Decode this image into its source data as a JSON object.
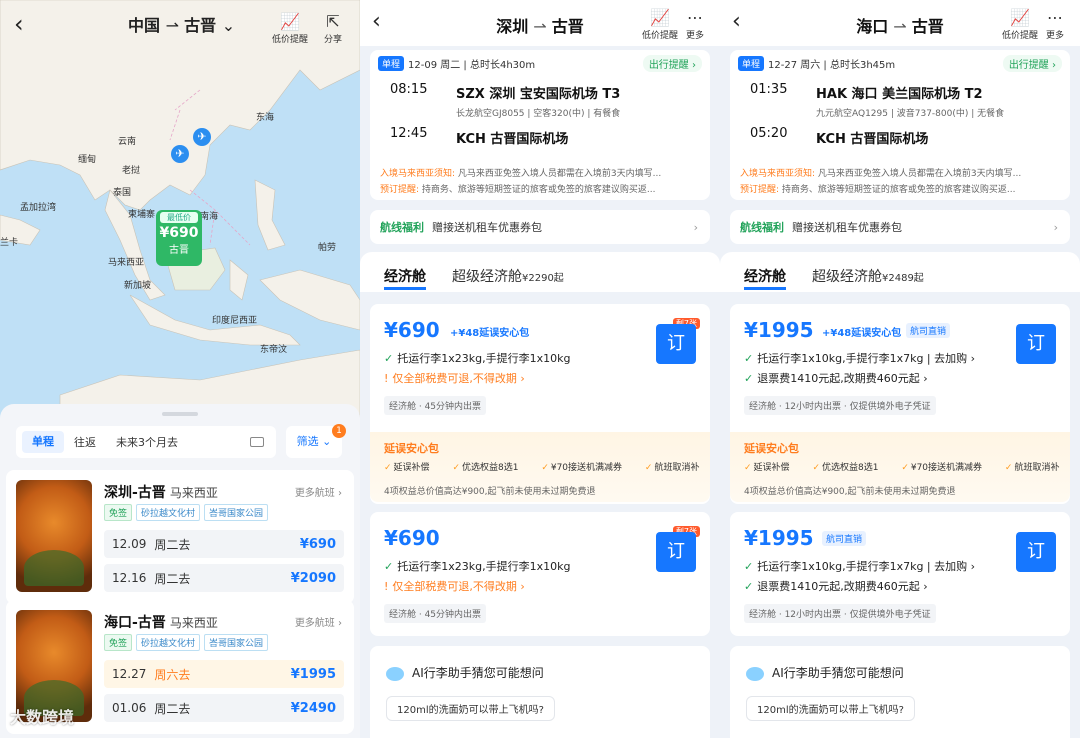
{
  "panel1": {
    "title_from": "中国",
    "title_to": "古晋",
    "tools": {
      "lowprice": "低价提醒",
      "share": "分享"
    },
    "map_labels": [
      "东海",
      "云南",
      "缅甸",
      "老挝",
      "泰国",
      "柬埔寨",
      "南海",
      "孟加拉湾",
      "兰卡",
      "马来西亚",
      "新加坡",
      "印度尼西亚",
      "东帝汶",
      "帕劳"
    ],
    "pin": {
      "tag": "最低价",
      "price": "¥690",
      "city": "古晋"
    },
    "search": {
      "oneway": "单程",
      "roundtrip": "往返",
      "range": "未来3个月去",
      "filter": "筛选",
      "filter_count": "1"
    },
    "routes": [
      {
        "name": "深圳-古晋",
        "country": "马来西亚",
        "more": "更多航班",
        "tags": [
          "免签",
          "砂拉越文化村",
          "峇哥国家公园"
        ],
        "dates": [
          {
            "date": "12.09",
            "week": "周二去",
            "price": "¥690"
          },
          {
            "date": "12.16",
            "week": "周二去",
            "price": "¥2090"
          }
        ]
      },
      {
        "name": "海口-古晋",
        "country": "马来西亚",
        "more": "更多航班",
        "tags": [
          "免签",
          "砂拉越文化村",
          "峇哥国家公园"
        ],
        "dates": [
          {
            "date": "12.27",
            "week": "周六去",
            "price": "¥1995"
          },
          {
            "date": "01.06",
            "week": "周二去",
            "price": "¥2490"
          }
        ]
      }
    ],
    "watermark": "大数跨境"
  },
  "panel2": {
    "from": "深圳",
    "to": "古晋",
    "tools": {
      "lowprice": "低价提醒",
      "more": "更多"
    },
    "flight": {
      "oneway": "单程",
      "date": "12-09 周二 | 总时长4h30m",
      "remind": "出行提醒",
      "dep_time": "08:15",
      "dep": "SZX  深圳 宝安国际机场 T3",
      "airline": "长龙航空GJ8055 | 空客320(中) | 有餐食",
      "arr_time": "12:45",
      "arr": "KCH    古晋国际机场"
    },
    "notice1": {
      "label": "入境马来西亚须知:",
      "text": "凡马来西亚免签入境人员都需在入境前3天内填写..."
    },
    "notice2": {
      "label": "预订提醒:",
      "text": "持商务、旅游等短期签证的旅客或免签的旅客建议购买返..."
    },
    "welfare": {
      "label": "航线福利",
      "text": "赠接送机租车优惠券包"
    },
    "cabins": {
      "economy": "经济舱",
      "premium": "超级经济舱",
      "premium_price": "¥2290起"
    },
    "offers": [
      {
        "price": "¥690",
        "pkg": "+¥48延误安心包",
        "left": "剩7张",
        "book": "订",
        "l1": "托运行李1x23kg,手提行李1x10kg",
        "l2": "仅全部税费可退,不得改期",
        "ticket": "经济舱 · 45分钟内出票",
        "insure": {
          "title": "延误安心包",
          "items": [
            "延误补偿",
            "优选权益8选1",
            "¥70接送机满减券",
            "航班取消补"
          ],
          "foot": "4项权益总价值高达¥900,起飞前未使用未过期免费退"
        }
      },
      {
        "price": "¥690",
        "left": "剩7张",
        "book": "订",
        "l1": "托运行李1x23kg,手提行李1x10kg",
        "l2": "仅全部税费可退,不得改期",
        "ticket": "经济舱 · 45分钟内出票"
      }
    ],
    "ai": {
      "title": "AI行李助手猜您可能想问",
      "q": "120ml的洗面奶可以带上飞机吗?"
    }
  },
  "panel3": {
    "from": "海口",
    "to": "古晋",
    "tools": {
      "lowprice": "低价提醒",
      "more": "更多"
    },
    "flight": {
      "oneway": "单程",
      "date": "12-27 周六 | 总时长3h45m",
      "remind": "出行提醒",
      "dep_time": "01:35",
      "dep": "HAK  海口 美兰国际机场 T2",
      "airline": "九元航空AQ1295 | 波音737-800(中) | 无餐食",
      "arr_time": "05:20",
      "arr": "KCH    古晋国际机场"
    },
    "notice1": {
      "label": "入境马来西亚须知:",
      "text": "凡马来西亚免签入境人员都需在入境前3天内填写..."
    },
    "notice2": {
      "label": "预订提醒:",
      "text": "持商务、旅游等短期签证的旅客或免签的旅客建议购买返..."
    },
    "welfare": {
      "label": "航线福利",
      "text": "赠接送机租车优惠券包"
    },
    "cabins": {
      "economy": "经济舱",
      "premium": "超级经济舱",
      "premium_price": "¥2489起"
    },
    "offers": [
      {
        "price": "¥1995",
        "pkg": "+¥48延误安心包",
        "direct": "航司直销",
        "book": "订",
        "l1": "托运行李1x10kg,手提行李1x7kg | 去加购",
        "l2": "退票费1410元起,改期费460元起",
        "ticket": "经济舱 · 12小时内出票 · 仅提供境外电子凭证",
        "insure": {
          "title": "延误安心包",
          "items": [
            "延误补偿",
            "优选权益8选1",
            "¥70接送机满减券",
            "航班取消补"
          ],
          "foot": "4项权益总价值高达¥900,起飞前未使用未过期免费退"
        }
      },
      {
        "price": "¥1995",
        "direct": "航司直销",
        "book": "订",
        "l1": "托运行李1x10kg,手提行李1x7kg | 去加购",
        "l2": "退票费1410元起,改期费460元起",
        "ticket": "经济舱 · 12小时内出票 · 仅提供境外电子凭证"
      }
    ],
    "ai": {
      "title": "AI行李助手猜您可能想问",
      "q": "120ml的洗面奶可以带上飞机吗?"
    }
  }
}
